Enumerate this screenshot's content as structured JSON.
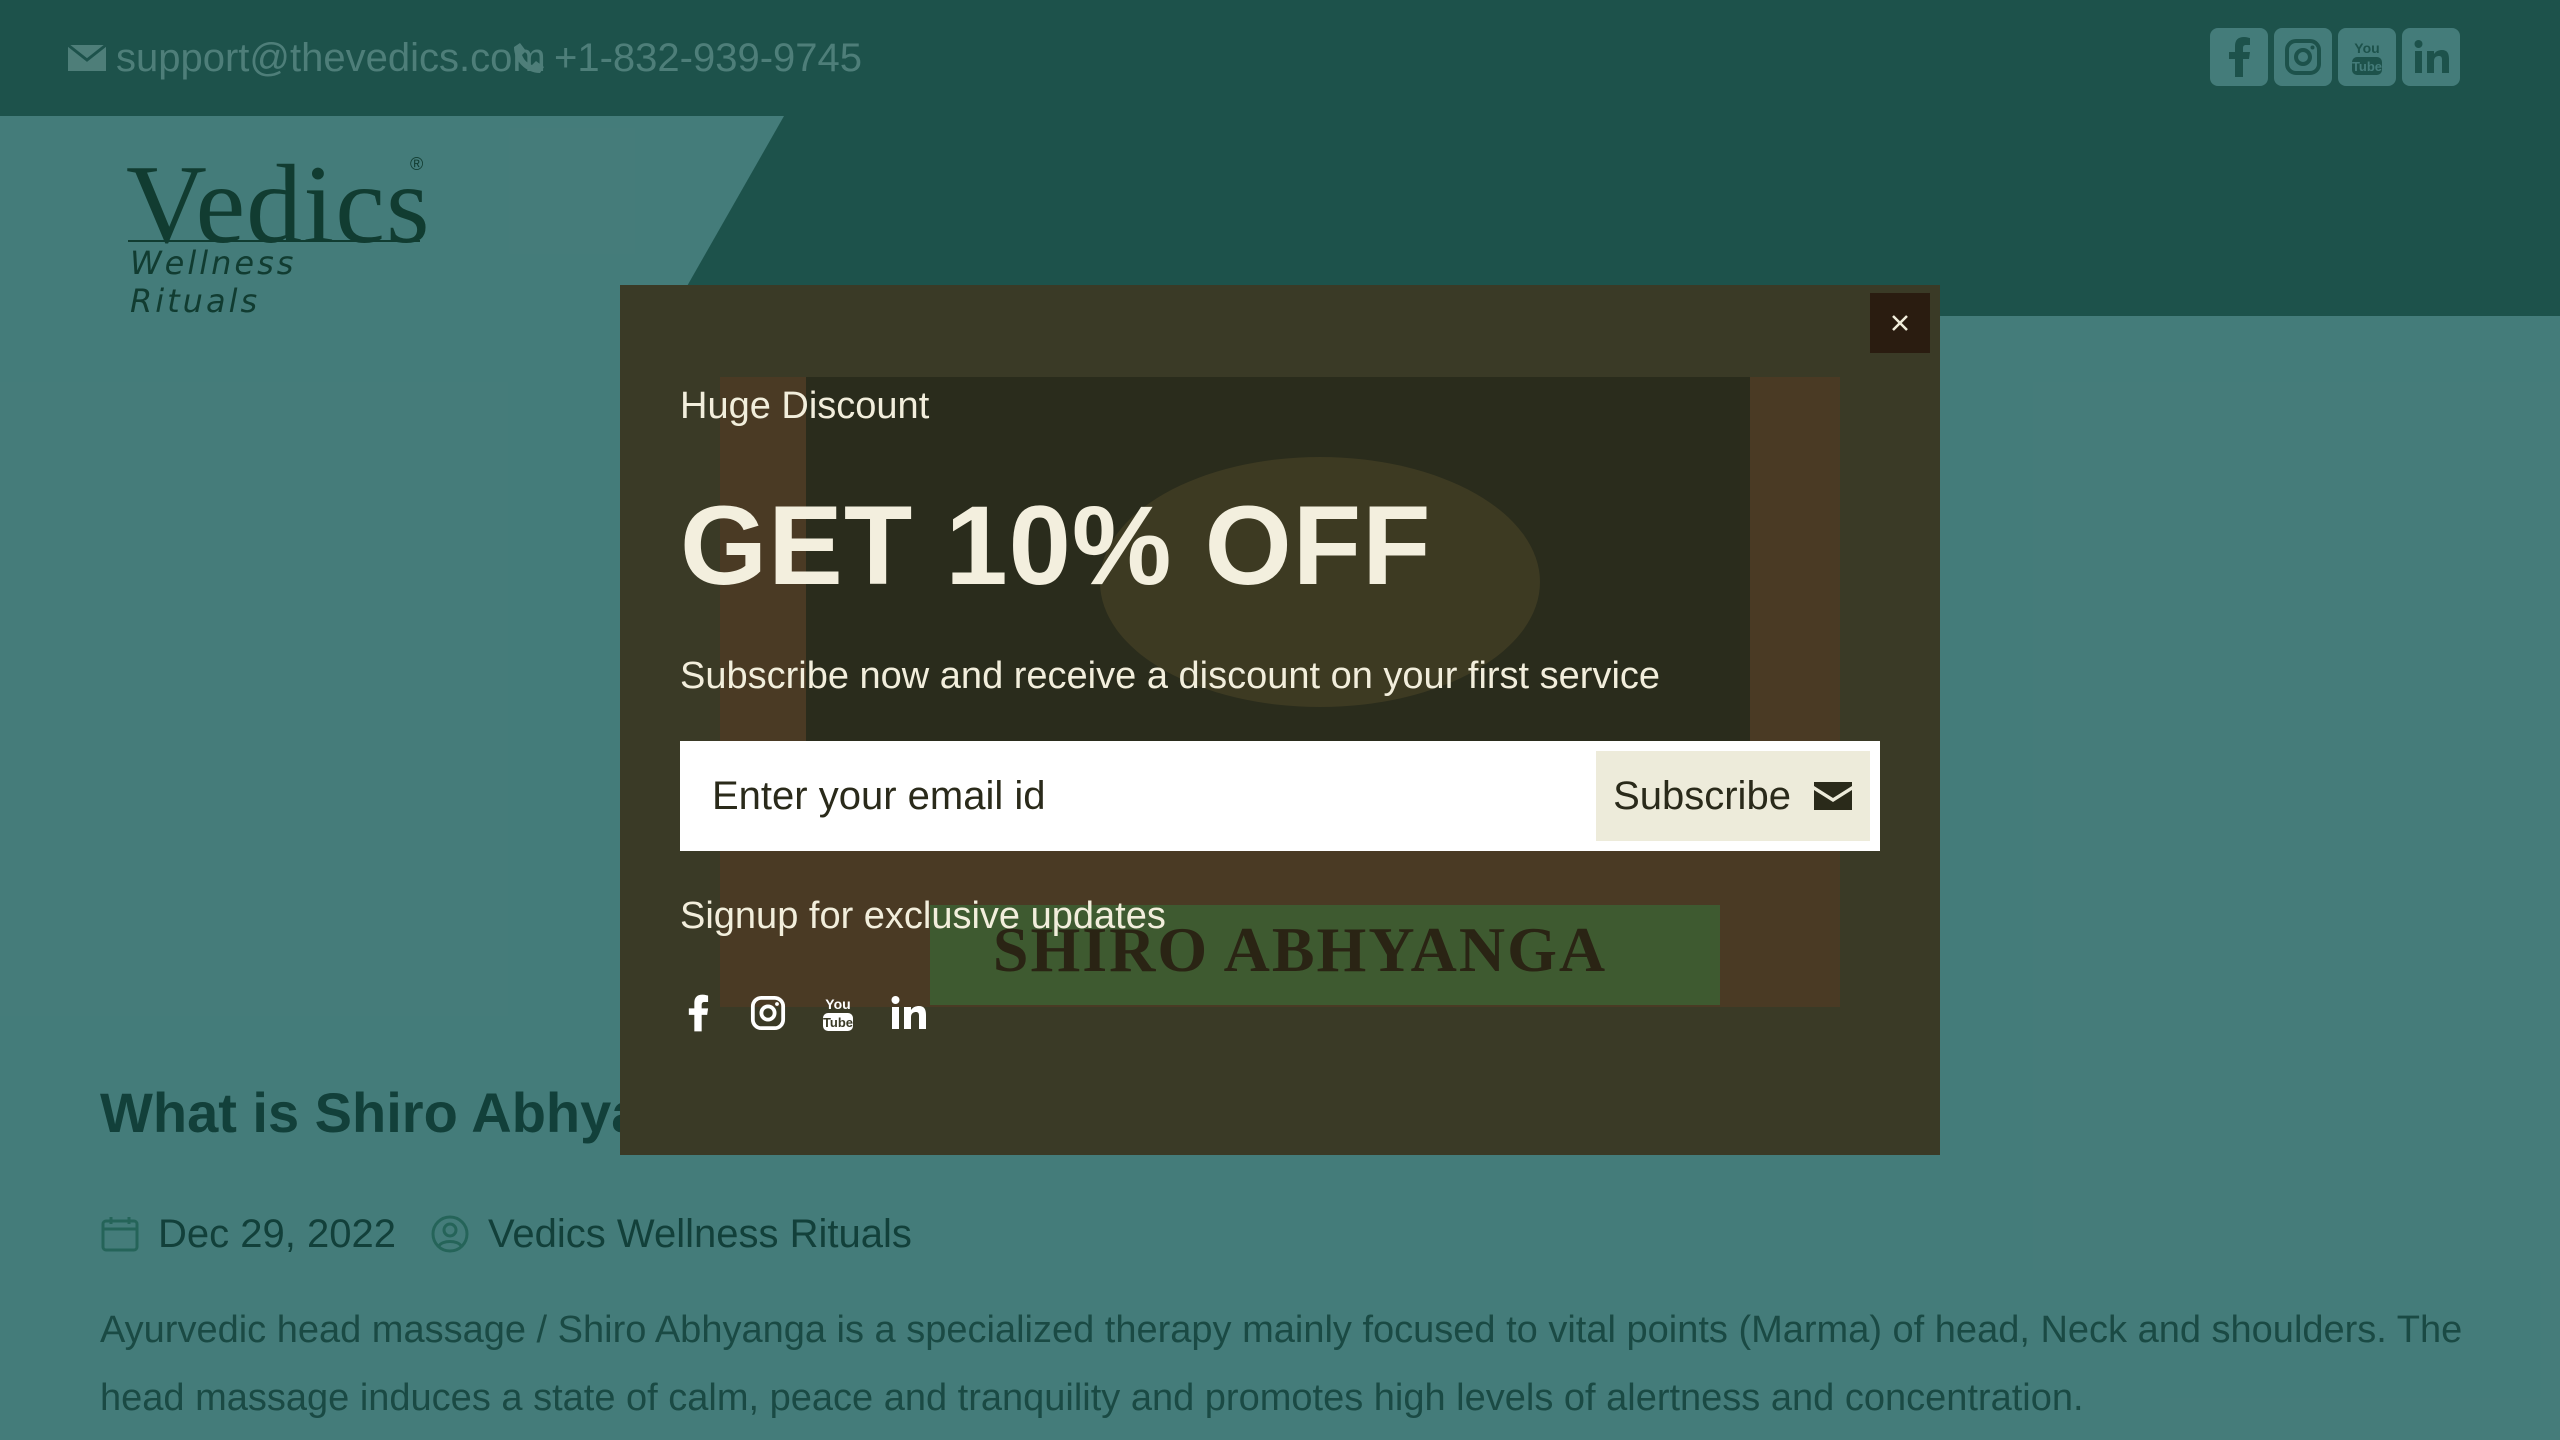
{
  "topbar": {
    "email": "support@thevedics.com",
    "phone": "+1-832-939-9745",
    "social": [
      "facebook-icon",
      "instagram-icon",
      "youtube-icon",
      "linkedin-icon"
    ]
  },
  "logo": {
    "word": "Vedics",
    "tagline": "Wellness Rituals",
    "reg": "®"
  },
  "article": {
    "title": "What is Shiro Abhyanga",
    "date": "Dec 29, 2022",
    "author": "Vedics Wellness Rituals",
    "body": "Ayurvedic head massage / Shiro Abhyanga is a specialized therapy mainly focused to vital points (Marma) of head, Neck and shoulders. The head massage induces a state of calm, peace and tranquility and promotes high levels of alertness and concentration."
  },
  "modal": {
    "background_image_text": "SHIRO ABHYANGA",
    "kicker": "Huge Discount",
    "headline": "GET 10% OFF",
    "subtext": "Subscribe now and receive a discount on your first service",
    "email_placeholder": "Enter your email id",
    "subscribe_label": "Subscribe",
    "signup_text": "Signup for exclusive updates",
    "social": [
      "facebook-icon",
      "instagram-icon",
      "youtube-icon",
      "linkedin-icon"
    ]
  },
  "colors": {
    "topbar": "#2f6d62",
    "page_bg": "#6fb0ad",
    "modal_bg": "#3a3a26",
    "subscribe_bg": "#edebda",
    "modal_text": "#f2eedc"
  }
}
